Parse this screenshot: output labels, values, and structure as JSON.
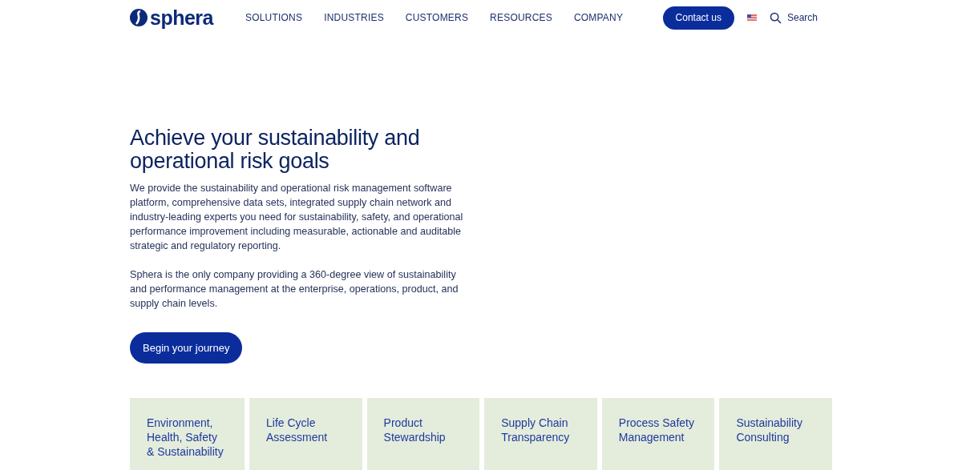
{
  "header": {
    "logo": "sphera",
    "nav": [
      {
        "label": "SOLUTIONS"
      },
      {
        "label": "INDUSTRIES"
      },
      {
        "label": "CUSTOMERS"
      },
      {
        "label": "RESOURCES"
      },
      {
        "label": "COMPANY"
      }
    ],
    "contact_button": "Contact us",
    "search": "Search"
  },
  "hero": {
    "title": "Achieve your sustainability and operational risk goals",
    "paragraphs": [
      "We provide the sustainability and operational risk management software platform, comprehensive data sets, integrated supply chain network and industry-leading experts you need for sustainability, safety, and operational performance improvement including measurable, actionable and auditable strategic and regulatory reporting.",
      "Sphera is the only company providing a 360-degree view of sustainability and performance management at the enterprise, operations, product, and supply chain levels."
    ],
    "button": "Begin your journey"
  },
  "cards": [
    {
      "label": "Environment, Health, Safety & Sustainability"
    },
    {
      "label": "Life Cycle Assessment"
    },
    {
      "label": "Product Stewardship"
    },
    {
      "label": "Supply Chain Transparency"
    },
    {
      "label": "Process Safety Management"
    },
    {
      "label": "Sustainability Consulting"
    }
  ]
}
